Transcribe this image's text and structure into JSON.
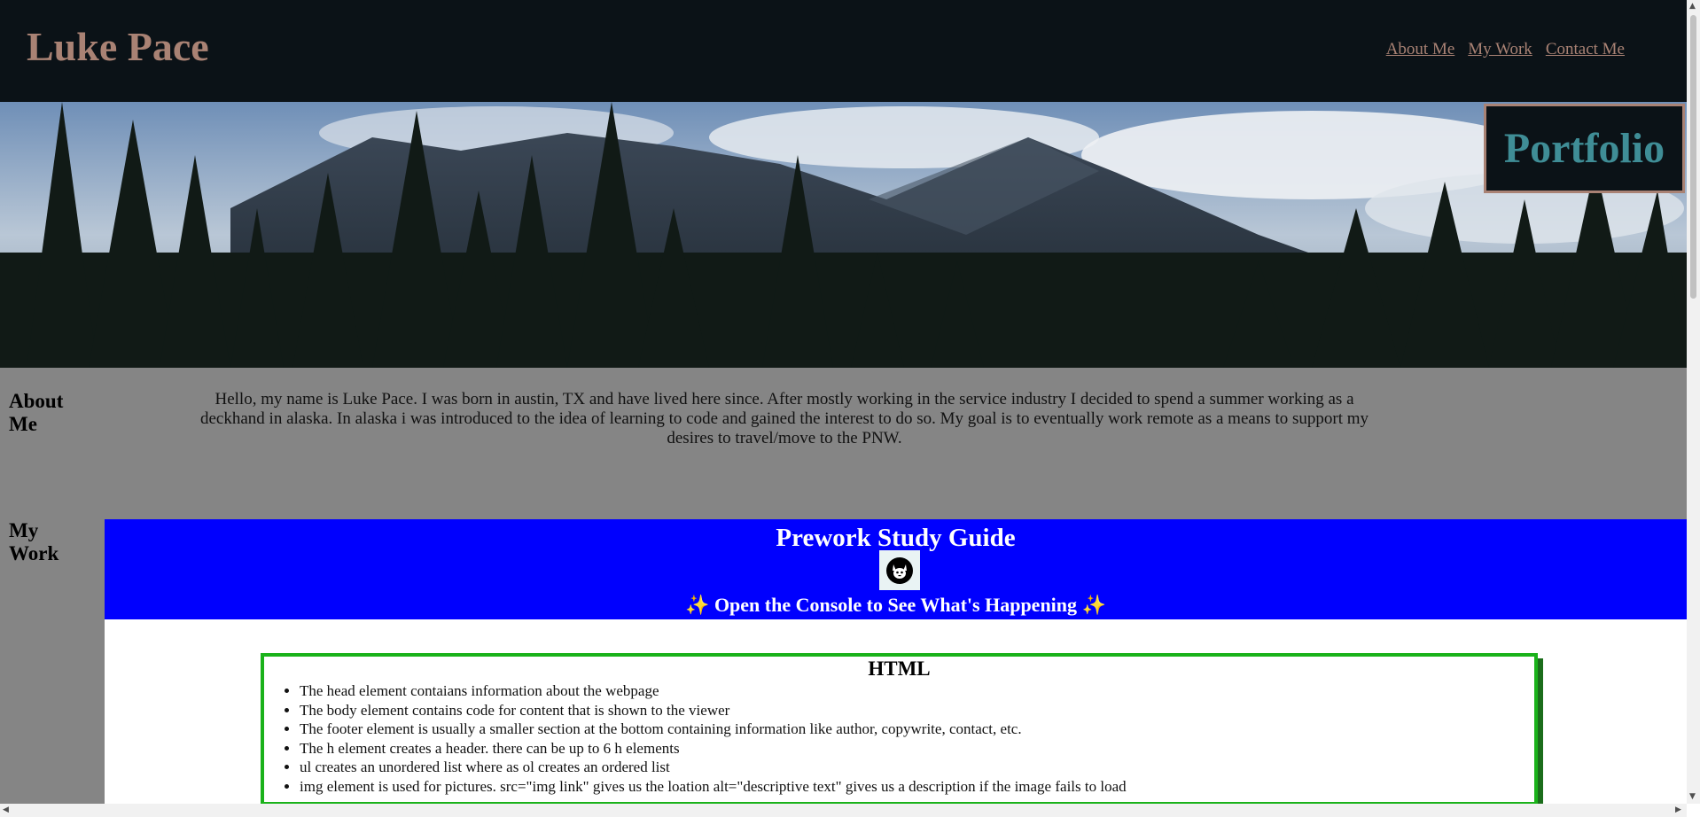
{
  "header": {
    "title": "Luke Pace",
    "nav": [
      {
        "label": "About Me"
      },
      {
        "label": "My Work"
      },
      {
        "label": "Contact Me"
      }
    ]
  },
  "hero": {
    "badge": "Portfolio"
  },
  "about": {
    "heading": "About Me",
    "text": "Hello, my name is Luke Pace. I was born in austin, TX and have lived here since. After mostly working in the service industry I decided to spend a summer working as a deckhand in alaska. In alaska i was introduced to the idea of learning to code and gained the interest to do so. My goal is to eventually work remote as a means to support my desires to travel/move to the PNW."
  },
  "work": {
    "heading": "My Work",
    "banner": {
      "title": "Prework Study Guide",
      "logo_icon": "cat-icon",
      "subtitle": "✨ Open the Console to See What's Happening ✨"
    },
    "card": {
      "title": "HTML",
      "items": [
        "The head element contaians information about the webpage",
        "The body element contains code for content that is shown to the viewer",
        "The footer element is usually a smaller section at the bottom containing information like author, copywrite, contact, etc.",
        "The h element creates a header. there can be up to 6 h elements",
        "ul creates an unordered list where as ol creates an ordered list",
        "img element is used for pictures. src=\"img link\" gives us the loation alt=\"descriptive text\" gives us a description if the image fails to load"
      ]
    }
  },
  "colors": {
    "header_bg": "#0b1217",
    "accent": "#a98274",
    "portfolio_text": "#3f8d96",
    "section_bg": "#858585",
    "banner_bg": "#0000fe",
    "card_border": "#1ab21a"
  }
}
